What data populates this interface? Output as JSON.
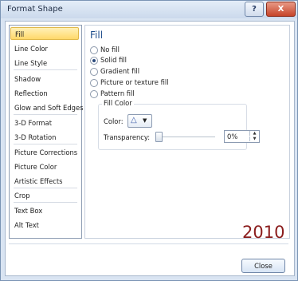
{
  "window": {
    "title": "Format Shape",
    "help_label": "?",
    "close_label": "X"
  },
  "nav": {
    "items": [
      {
        "label": "Fill"
      },
      {
        "label": "Line Color"
      },
      {
        "label": "Line Style"
      },
      {
        "label": "Shadow"
      },
      {
        "label": "Reflection"
      },
      {
        "label": "Glow and Soft Edges"
      },
      {
        "label": "3-D Format"
      },
      {
        "label": "3-D Rotation"
      },
      {
        "label": "Picture Corrections"
      },
      {
        "label": "Picture Color"
      },
      {
        "label": "Artistic Effects"
      },
      {
        "label": "Crop"
      },
      {
        "label": "Text Box"
      },
      {
        "label": "Alt Text"
      }
    ],
    "selected": "Fill"
  },
  "fill": {
    "heading": "Fill",
    "options": [
      {
        "label": "No fill",
        "checked": false
      },
      {
        "label": "Solid fill",
        "checked": true
      },
      {
        "label": "Gradient fill",
        "checked": false
      },
      {
        "label": "Picture or texture fill",
        "checked": false
      },
      {
        "label": "Pattern fill",
        "checked": false
      }
    ],
    "fill_color": {
      "group_title": "Fill Color",
      "color_label": "Color:",
      "transparency_label": "Transparency:",
      "transparency_value": "0%",
      "transparency_fraction": 0
    }
  },
  "version_mark": "2010",
  "footer": {
    "close_label": "Close"
  }
}
